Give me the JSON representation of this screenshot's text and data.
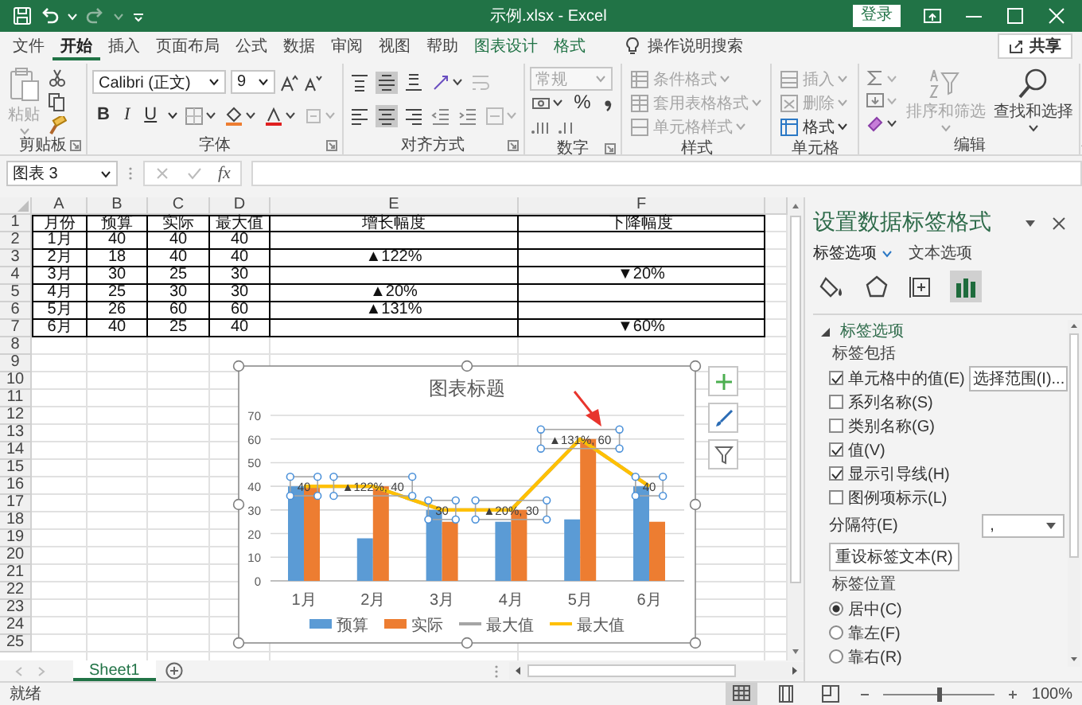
{
  "window": {
    "title": "示例.xlsx - Excel",
    "login_button": "登录"
  },
  "ribbon_tabs": [
    {
      "label": "文件",
      "selected": false,
      "contextual": false
    },
    {
      "label": "开始",
      "selected": true,
      "contextual": false
    },
    {
      "label": "插入",
      "selected": false,
      "contextual": false
    },
    {
      "label": "页面布局",
      "selected": false,
      "contextual": false
    },
    {
      "label": "公式",
      "selected": false,
      "contextual": false
    },
    {
      "label": "数据",
      "selected": false,
      "contextual": false
    },
    {
      "label": "审阅",
      "selected": false,
      "contextual": false
    },
    {
      "label": "视图",
      "selected": false,
      "contextual": false
    },
    {
      "label": "帮助",
      "selected": false,
      "contextual": false
    },
    {
      "label": "图表设计",
      "selected": false,
      "contextual": true
    },
    {
      "label": "格式",
      "selected": false,
      "contextual": true
    }
  ],
  "tell_me": "操作说明搜索",
  "share_button": "共享",
  "ribbon": {
    "clipboard": {
      "label": "剪贴板",
      "paste": {
        "label": "粘贴",
        "disabled": true
      }
    },
    "font": {
      "label": "字体",
      "font_name": "Calibri (正文)",
      "font_size": "9",
      "style_buttons": [
        "B",
        "I",
        "U"
      ]
    },
    "alignment": {
      "label": "对齐方式",
      "vertical": [
        {
          "selected": false
        },
        {
          "selected": true
        },
        {
          "selected": false
        }
      ],
      "horizontal": [
        {
          "selected": false
        },
        {
          "selected": true
        },
        {
          "selected": false
        }
      ]
    },
    "number": {
      "label": "数字",
      "format": {
        "value": "常规",
        "disabled": true
      },
      "percent_button": "%"
    },
    "styles": {
      "label": "样式",
      "items": [
        {
          "label": "条件格式",
          "disabled": true
        },
        {
          "label": "套用表格格式",
          "disabled": true
        },
        {
          "label": "单元格样式",
          "disabled": true
        }
      ]
    },
    "cells": {
      "label": "单元格",
      "items": [
        {
          "label": "插入",
          "disabled": true
        },
        {
          "label": "删除",
          "disabled": true
        },
        {
          "label": "格式",
          "disabled": false
        }
      ]
    },
    "editing": {
      "label": "编辑",
      "items": [
        {
          "label": "排序和筛选",
          "disabled": true
        },
        {
          "label": "查找和选择",
          "disabled": false
        }
      ]
    }
  },
  "formula_bar": {
    "name_box": "图表 3",
    "function_button": "fx"
  },
  "sheet": {
    "columns": [
      "A",
      "B",
      "C",
      "D",
      "E",
      "F"
    ],
    "row_numbers": [
      "1",
      "2",
      "3",
      "4",
      "5",
      "6",
      "7",
      "8",
      "9",
      "10",
      "11",
      "12",
      "13",
      "14",
      "15",
      "16",
      "17",
      "18",
      "19",
      "20",
      "21",
      "22",
      "23",
      "24",
      "25"
    ],
    "rows": [
      [
        "月份",
        "预算",
        "实际",
        "最大值",
        "增长幅度",
        "下降幅度"
      ],
      [
        "1月",
        "40",
        "40",
        "40",
        null,
        null
      ],
      [
        "2月",
        "18",
        "40",
        "40",
        "▲122%",
        null
      ],
      [
        "3月",
        "30",
        "25",
        "30",
        null,
        "▼20%"
      ],
      [
        "4月",
        "25",
        "30",
        "30",
        "▲20%",
        null
      ],
      [
        "5月",
        "26",
        "60",
        "60",
        "▲131%",
        null
      ],
      [
        "6月",
        "40",
        "25",
        "40",
        null,
        "▼60%"
      ]
    ]
  },
  "chart": {
    "selected": true,
    "chart_data": {
      "type": "bar",
      "title": "图表标题",
      "categories": [
        "1月",
        "2月",
        "3月",
        "4月",
        "5月",
        "6月"
      ],
      "series": [
        {
          "name": "预算",
          "type": "bar",
          "color": "#5b9bd5",
          "values": [
            40,
            18,
            30,
            25,
            26,
            40
          ]
        },
        {
          "name": "实际",
          "type": "bar",
          "color": "#ed7d31",
          "values": [
            40,
            40,
            25,
            30,
            60,
            25
          ]
        },
        {
          "name": "最大值",
          "type": "line",
          "color": "#a5a5a5",
          "values": [
            40,
            40,
            30,
            30,
            60,
            40
          ]
        },
        {
          "name": "最大值",
          "type": "line",
          "color": "#ffc000",
          "values": [
            40,
            40,
            30,
            30,
            60,
            40
          ]
        }
      ],
      "ylim": [
        0,
        70
      ],
      "yticks": [
        0,
        10,
        20,
        30,
        40,
        50,
        60,
        70
      ],
      "grid": true,
      "legend": true
    },
    "point_labels": {
      "selected": true,
      "texts": [
        "40",
        "▲122%, 40",
        "30",
        "▲20%, 30",
        "▲131%, 60",
        "40"
      ]
    }
  },
  "sheet_tabs": [
    {
      "label": "Sheet1",
      "selected": true
    }
  ],
  "format_pane": {
    "title": "设置数据标签格式",
    "tabs": [
      {
        "label": "标签选项",
        "selected": true
      },
      {
        "label": "文本选项",
        "selected": false
      }
    ],
    "icon_tabs": [
      {
        "selected": false
      },
      {
        "selected": false
      },
      {
        "selected": false
      },
      {
        "selected": true
      }
    ],
    "section": {
      "label": "标签选项",
      "expanded": true
    },
    "group_label": "标签包括",
    "options": [
      {
        "label": "单元格中的值(E)",
        "checked": true,
        "button": "选择范围(I)..."
      },
      {
        "label": "系列名称(S)",
        "checked": false
      },
      {
        "label": "类别名称(G)",
        "checked": false
      },
      {
        "label": "值(V)",
        "checked": true
      },
      {
        "label": "显示引导线(H)",
        "checked": true
      },
      {
        "label": "图例项标示(L)",
        "checked": false
      }
    ],
    "separator": {
      "label": "分隔符(E)",
      "value": ","
    },
    "reset_button": "重设标签文本(R)",
    "position_label": "标签位置",
    "positions": [
      {
        "label": "居中(C)",
        "selected": true
      },
      {
        "label": "靠左(F)",
        "selected": false
      },
      {
        "label": "靠右(R)",
        "selected": false
      }
    ]
  },
  "status_bar": {
    "text": "就绪",
    "views": [
      {
        "selected": true
      },
      {
        "selected": false
      },
      {
        "selected": false
      }
    ],
    "zoom": {
      "level": 0.5,
      "reading": "100%"
    }
  }
}
